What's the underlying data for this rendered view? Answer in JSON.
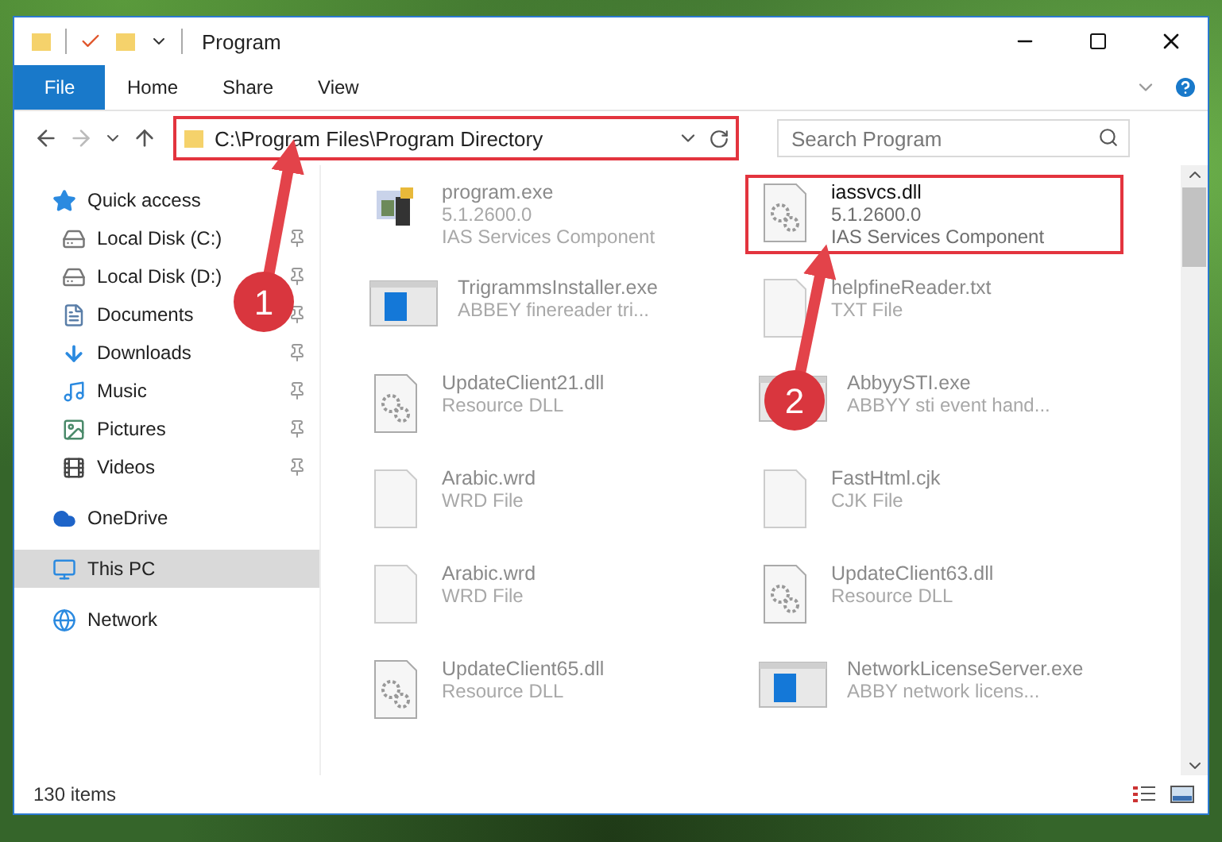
{
  "window": {
    "title": "Program"
  },
  "ribbon": {
    "tabs": [
      {
        "label": "File",
        "kind": "file"
      },
      {
        "label": "Home",
        "kind": "tab"
      },
      {
        "label": "Share",
        "kind": "tab"
      },
      {
        "label": "View",
        "kind": "tab"
      }
    ]
  },
  "address": {
    "path": "C:\\Program Files\\Program Directory",
    "highlighted": true
  },
  "search": {
    "placeholder": "Search Program"
  },
  "sidebar": {
    "items": [
      {
        "label": "Quick access",
        "selected": false,
        "children": [
          {
            "label": "Local Disk (C:)",
            "pinned": true,
            "selected": false
          },
          {
            "label": "Local Disk (D:)",
            "pinned": true,
            "selected": false
          },
          {
            "label": "Documents",
            "pinned": true,
            "selected": false
          },
          {
            "label": "Downloads",
            "pinned": true,
            "selected": false
          },
          {
            "label": "Music",
            "pinned": true,
            "selected": false
          },
          {
            "label": "Pictures",
            "pinned": true,
            "selected": false
          },
          {
            "label": "Videos",
            "pinned": true,
            "selected": false
          }
        ]
      },
      {
        "label": "OneDrive",
        "selected": false
      },
      {
        "label": "This PC",
        "selected": true
      },
      {
        "label": "Network",
        "selected": false
      }
    ]
  },
  "files": [
    {
      "name": "program.exe",
      "details": [
        "5.1.2600.0",
        "IAS Services Component"
      ],
      "kind": "app",
      "highlighted": false
    },
    {
      "name": "iassvcs.dll",
      "details": [
        "5.1.2600.0",
        "IAS Services Component"
      ],
      "kind": "dll",
      "highlighted": true
    },
    {
      "name": "TrigrammsInstaller.exe",
      "details": [
        "ABBEY finereader tri..."
      ],
      "kind": "window",
      "highlighted": false
    },
    {
      "name": "helpfineReader.txt",
      "details": [
        "TXT File"
      ],
      "kind": "blank",
      "highlighted": false
    },
    {
      "name": "UpdateClient21.dll",
      "details": [
        "Resource DLL"
      ],
      "kind": "dll",
      "highlighted": false
    },
    {
      "name": "AbbyySTI.exe",
      "details": [
        "ABBYY sti event hand..."
      ],
      "kind": "window",
      "highlighted": false
    },
    {
      "name": "Arabic.wrd",
      "details": [
        "WRD File"
      ],
      "kind": "blank",
      "highlighted": false
    },
    {
      "name": "FastHtml.cjk",
      "details": [
        "CJK File"
      ],
      "kind": "blank",
      "highlighted": false
    },
    {
      "name": "Arabic.wrd",
      "details": [
        "WRD File"
      ],
      "kind": "blank",
      "highlighted": false
    },
    {
      "name": "UpdateClient63.dll",
      "details": [
        "Resource DLL"
      ],
      "kind": "dll",
      "highlighted": false
    },
    {
      "name": "UpdateClient65.dll",
      "details": [
        "Resource DLL"
      ],
      "kind": "dll",
      "highlighted": false
    },
    {
      "name": "NetworkLicenseServer.exe",
      "details": [
        "ABBY network licens..."
      ],
      "kind": "window",
      "highlighted": false
    }
  ],
  "status_bar": {
    "count": "130 items"
  },
  "annotations": [
    {
      "number": "1"
    },
    {
      "number": "2"
    }
  ]
}
